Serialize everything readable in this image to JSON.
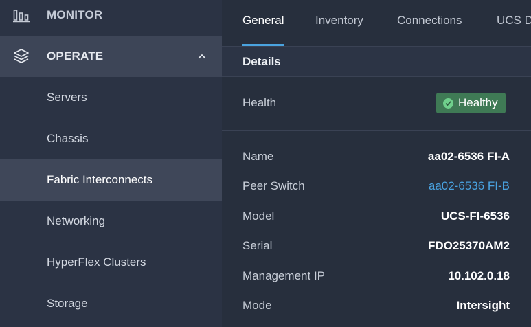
{
  "sidebar": {
    "monitor": {
      "label": "MONITOR",
      "icon": "bar-chart-icon"
    },
    "operate": {
      "label": "OPERATE",
      "icon": "layers-icon",
      "expanded": true
    },
    "sub_items": [
      {
        "label": "Servers",
        "active": false
      },
      {
        "label": "Chassis",
        "active": false
      },
      {
        "label": "Fabric Interconnects",
        "active": true
      },
      {
        "label": "Networking",
        "active": false
      },
      {
        "label": "HyperFlex Clusters",
        "active": false
      },
      {
        "label": "Storage",
        "active": false
      }
    ]
  },
  "tabs": [
    {
      "label": "General",
      "active": true
    },
    {
      "label": "Inventory",
      "active": false
    },
    {
      "label": "Connections",
      "active": false
    },
    {
      "label": "UCS D",
      "active": false
    }
  ],
  "details": {
    "title": "Details",
    "health": {
      "label": "Health",
      "value": "Healthy",
      "color": "#3f7a55"
    },
    "properties": [
      {
        "label": "Name",
        "value": "aa02-6536 FI-A"
      },
      {
        "label": "Peer Switch",
        "value": "aa02-6536 FI-B",
        "link": true
      },
      {
        "label": "Model",
        "value": "UCS-FI-6536"
      },
      {
        "label": "Serial",
        "value": "FDO25370AM2"
      },
      {
        "label": "Management IP",
        "value": "10.102.0.18"
      },
      {
        "label": "Mode",
        "value": "Intersight"
      }
    ]
  },
  "colors": {
    "accent": "#4aa3df",
    "link": "#49a2e0",
    "healthy": "#3f7a55"
  }
}
